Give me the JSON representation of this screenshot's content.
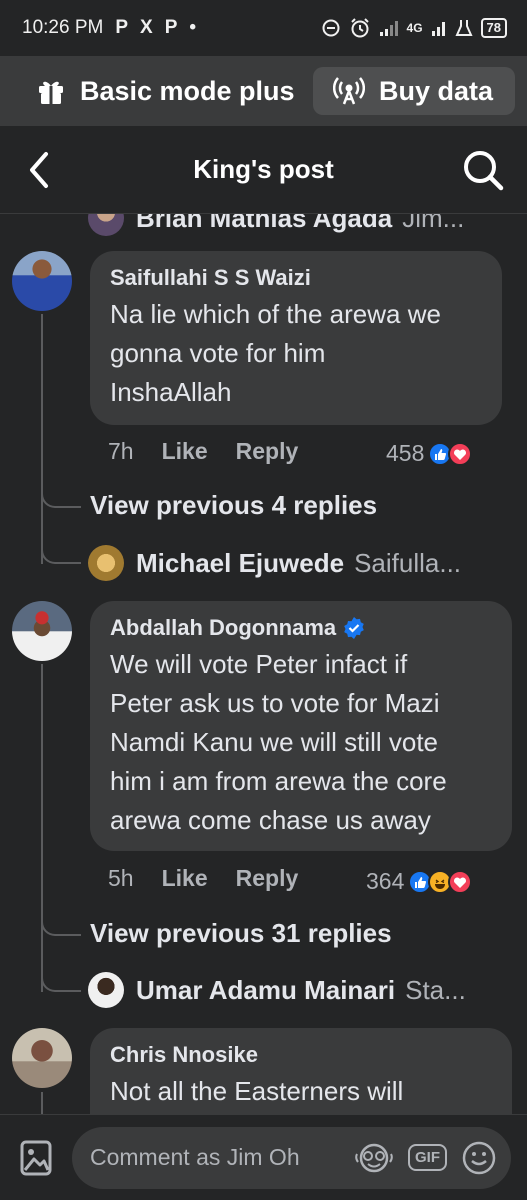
{
  "status_bar": {
    "time": "10:26 PM",
    "app_icons": [
      "P",
      "X",
      "P",
      "•"
    ],
    "network": "4G",
    "battery": "78"
  },
  "promo": {
    "label": "Basic mode plus",
    "buy_label": "Buy data"
  },
  "header": {
    "title": "King's post"
  },
  "top_reply": {
    "name": "Brian Mathias Agada",
    "snippet": "Jim..."
  },
  "comments": [
    {
      "author": "Saifullahi S S Waizi",
      "verified": false,
      "text_lines": [
        "Na lie which of the arewa we",
        "gonna vote for him",
        "InshaAllah"
      ],
      "time": "7h",
      "like_label": "Like",
      "reply_label": "Reply",
      "reaction_count": "458",
      "view_replies": "View previous 4 replies",
      "reply_preview": {
        "name": "Michael Ejuwede",
        "snippet": "Saifulla..."
      }
    },
    {
      "author": "Abdallah Dogonnama",
      "verified": true,
      "text_lines": [
        "We will vote Peter infact if",
        "Peter ask us to vote for Mazi",
        "Namdi Kanu we will still vote",
        "him i am from arewa the core",
        "arewa come chase us away"
      ],
      "time": "5h",
      "like_label": "Like",
      "reply_label": "Reply",
      "reaction_count": "364",
      "view_replies": "View previous 31 replies",
      "reply_preview": {
        "name": "Umar Adamu Mainari",
        "snippet": "Sta..."
      }
    },
    {
      "author": "Chris Nnosike",
      "verified": false,
      "text_lines": [
        "Not all the Easterners will"
      ]
    }
  ],
  "comment_bar": {
    "placeholder": "Comment as Jim Oh",
    "gif_label": "GIF"
  },
  "colors": {
    "background": "#242526",
    "bubble": "#3a3b3c",
    "like_blue": "#1877f2",
    "love_red": "#f33e58",
    "haha_yellow": "#f7b125"
  }
}
